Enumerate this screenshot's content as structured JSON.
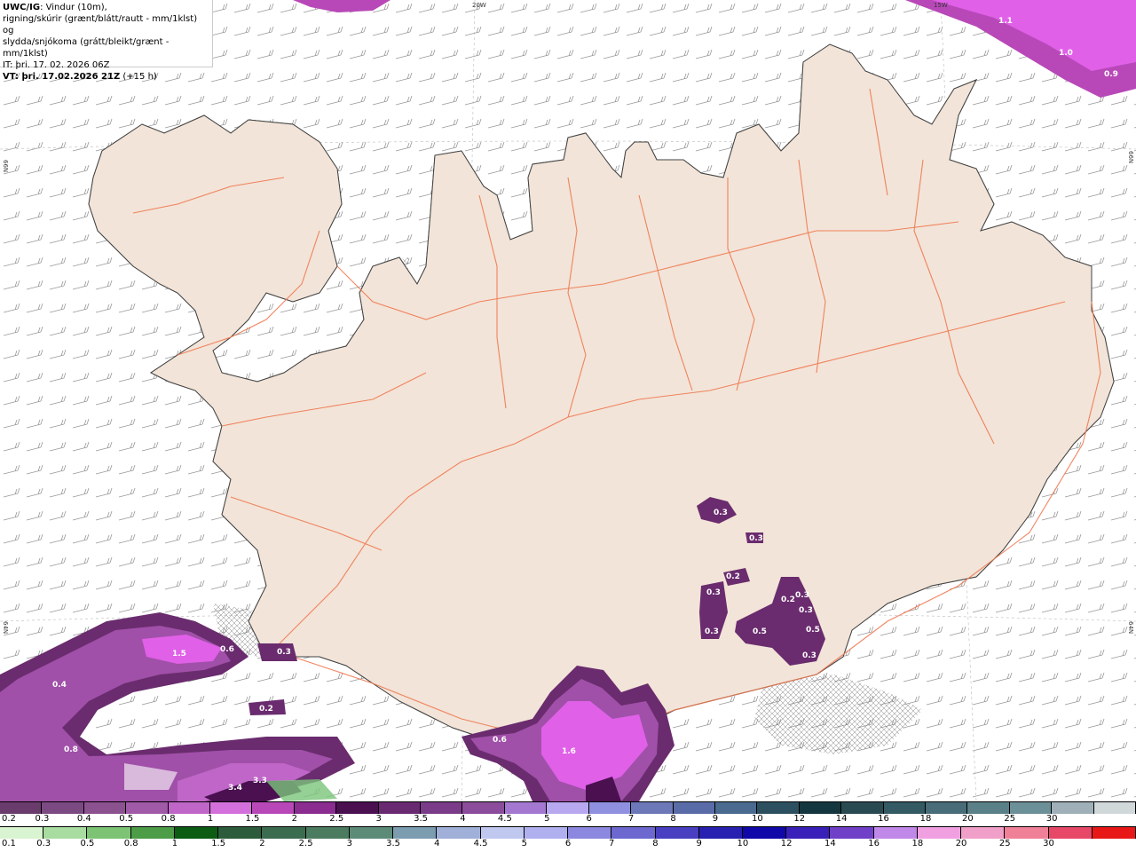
{
  "header": {
    "model": "UWC/IG",
    "line1_rest": ": Vindur (10m),",
    "line2": "rigning/skúrir (grænt/blátt/rautt - mm/1klst) og",
    "line3": "slydda/snjókoma (grátt/bleikt/grænt - mm/1klst)",
    "init_time": "IT: þri. 17. 02. 2026 06Z",
    "valid_prefix": "VT: þri. 17.02.2026 21Z",
    "valid_suffix": " (+15 h)"
  },
  "grid_labels": {
    "lon_20w": "20W",
    "lon_15w": "15W",
    "lat_66n_left": "66N",
    "lat_66n_right": "66N",
    "lat_64n_left": "64N",
    "lat_64n_right": "64N"
  },
  "colors": {
    "land": "#f2e4d8",
    "roads": "#f07850",
    "sea": "#ffffff",
    "snow_dark": "#6a2c6e",
    "snow_mid": "#b04ab8",
    "snow_light": "#e060e8",
    "rain_green": "#7bc47b"
  },
  "precip_labels": [
    {
      "text": "1.1"
    },
    {
      "text": "1.0"
    },
    {
      "text": "0.9"
    },
    {
      "text": "0.3"
    },
    {
      "text": "0.3"
    },
    {
      "text": "0.2"
    },
    {
      "text": "0.3"
    },
    {
      "text": "0.2"
    },
    {
      "text": "0.3"
    },
    {
      "text": "0.3"
    },
    {
      "text": "0.3"
    },
    {
      "text": "0.5"
    },
    {
      "text": "0.5"
    },
    {
      "text": "0.3"
    },
    {
      "text": "1.5"
    },
    {
      "text": "0.6"
    },
    {
      "text": "0.3"
    },
    {
      "text": "0.4"
    },
    {
      "text": "0.2"
    },
    {
      "text": "0.6"
    },
    {
      "text": "0.8"
    },
    {
      "text": "1.6"
    },
    {
      "text": "3.4"
    },
    {
      "text": "3.3"
    }
  ],
  "legend_snow": {
    "colors": [
      "#6a3c6e",
      "#7c4a82",
      "#8c5290",
      "#a05aa8",
      "#c066c8",
      "#d470dc",
      "#b848b8",
      "#8a2c90",
      "#4a1050",
      "#6a2a72",
      "#7a3c88",
      "#8c4c9c",
      "#a478d0",
      "#b8a8f0",
      "#9090e0",
      "#6c78b8",
      "#5a6ca8",
      "#4a6a90",
      "#2c5060",
      "#14363e",
      "#2a4a52",
      "#345a64",
      "#486c78",
      "#5a8088",
      "#6c9098",
      "#a0b0b8",
      "#d0d8da"
    ],
    "labels": [
      "0.2",
      "0.3",
      "0.4",
      "0.5",
      "0.8",
      "1",
      "1.5",
      "2",
      "2.5",
      "3",
      "3.5",
      "4",
      "4.5",
      "5",
      "6",
      "7",
      "8",
      "9",
      "10",
      "12",
      "14",
      "16",
      "18",
      "20",
      "25",
      "30"
    ]
  },
  "legend_rain": {
    "colors": [
      "#d8f4d0",
      "#a8dca0",
      "#7cc474",
      "#4c9c48",
      "#0c5c14",
      "#2c5c3c",
      "#3c6c50",
      "#4c7c60",
      "#5c8c78",
      "#7c9cb0",
      "#a0b0d8",
      "#c0c8f0",
      "#b0b0f0",
      "#8c88e0",
      "#6c68d0",
      "#4840c0",
      "#2820b0",
      "#1008a8",
      "#3820b8",
      "#7040c8",
      "#c088e8",
      "#f0a0e0",
      "#f0a0c8",
      "#f08098",
      "#e84868",
      "#e81818"
    ],
    "labels": [
      "0.1",
      "0.3",
      "0.5",
      "0.8",
      "1",
      "1.5",
      "2",
      "2.5",
      "3",
      "3.5",
      "4",
      "4.5",
      "5",
      "6",
      "7",
      "8",
      "9",
      "10",
      "12",
      "14",
      "16",
      "18",
      "20",
      "25",
      "30"
    ]
  }
}
